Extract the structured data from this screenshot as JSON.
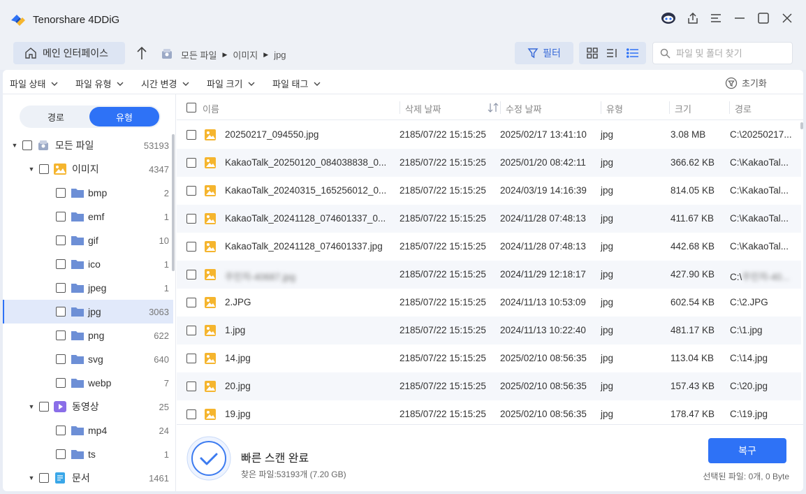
{
  "app": {
    "title": "Tenorshare 4DDiG"
  },
  "toolbar": {
    "home_label": "메인 인터페이스",
    "breadcrumb": [
      "모든 파일",
      "이미지",
      "jpg"
    ],
    "filter_label": "필터",
    "search_placeholder": "파일 및 폴더 찾기"
  },
  "filters": {
    "items": [
      "파일 상태",
      "파일 유형",
      "시간 변경",
      "파일 크기",
      "파일 태그"
    ],
    "reset_label": "초기화"
  },
  "sidebar": {
    "tabs": [
      "경로",
      "유형"
    ],
    "active_tab": "유형",
    "tree": [
      {
        "label": "모든 파일",
        "count": "53193"
      },
      {
        "label": "이미지",
        "count": "4347"
      },
      {
        "label": "bmp",
        "count": "2"
      },
      {
        "label": "emf",
        "count": "1"
      },
      {
        "label": "gif",
        "count": "10"
      },
      {
        "label": "ico",
        "count": "1"
      },
      {
        "label": "jpeg",
        "count": "1"
      },
      {
        "label": "jpg",
        "count": "3063"
      },
      {
        "label": "png",
        "count": "622"
      },
      {
        "label": "svg",
        "count": "640"
      },
      {
        "label": "webp",
        "count": "7"
      },
      {
        "label": "동영상",
        "count": "25"
      },
      {
        "label": "mp4",
        "count": "24"
      },
      {
        "label": "ts",
        "count": "1"
      },
      {
        "label": "문서",
        "count": "1461"
      }
    ]
  },
  "table": {
    "columns": [
      "이름",
      "삭제 날짜",
      "수정 날짜",
      "유형",
      "크기",
      "경로"
    ],
    "rows": [
      {
        "name": "20250217_094550.jpg",
        "deleted": "2185/07/22 15:15:25",
        "modified": "2025/02/17 13:41:10",
        "type": "jpg",
        "size": "3.08 MB",
        "path": "C:\\20250217..."
      },
      {
        "name": "KakaoTalk_20250120_084038838_0...",
        "deleted": "2185/07/22 15:15:25",
        "modified": "2025/01/20 08:42:11",
        "type": "jpg",
        "size": "366.62 KB",
        "path": "C:\\KakaoTal..."
      },
      {
        "name": "KakaoTalk_20240315_165256012_0...",
        "deleted": "2185/07/22 15:15:25",
        "modified": "2024/03/19 14:16:39",
        "type": "jpg",
        "size": "814.05 KB",
        "path": "C:\\KakaoTal..."
      },
      {
        "name": "KakaoTalk_20241128_074601337_0...",
        "deleted": "2185/07/22 15:15:25",
        "modified": "2024/11/28 07:48:13",
        "type": "jpg",
        "size": "411.67 KB",
        "path": "C:\\KakaoTal..."
      },
      {
        "name": "KakaoTalk_20241128_074601337.jpg",
        "deleted": "2185/07/22 15:15:25",
        "modified": "2024/11/28 07:48:13",
        "type": "jpg",
        "size": "442.68 KB",
        "path": "C:\\KakaoTal..."
      },
      {
        "name": "주민차-40687.jpg",
        "deleted": "2185/07/22 15:15:25",
        "modified": "2024/11/29 12:18:17",
        "type": "jpg",
        "size": "427.90 KB",
        "path": "C:\\주민차-40...",
        "blurred": true
      },
      {
        "name": "2.JPG",
        "deleted": "2185/07/22 15:15:25",
        "modified": "2024/11/13 10:53:09",
        "type": "jpg",
        "size": "602.54 KB",
        "path": "C:\\2.JPG"
      },
      {
        "name": "1.jpg",
        "deleted": "2185/07/22 15:15:25",
        "modified": "2024/11/13 10:22:40",
        "type": "jpg",
        "size": "481.17 KB",
        "path": "C:\\1.jpg"
      },
      {
        "name": "14.jpg",
        "deleted": "2185/07/22 15:15:25",
        "modified": "2025/02/10 08:56:35",
        "type": "jpg",
        "size": "113.04 KB",
        "path": "C:\\14.jpg"
      },
      {
        "name": "20.jpg",
        "deleted": "2185/07/22 15:15:25",
        "modified": "2025/02/10 08:56:35",
        "type": "jpg",
        "size": "157.43 KB",
        "path": "C:\\20.jpg"
      },
      {
        "name": "19.jpg",
        "deleted": "2185/07/22 15:15:25",
        "modified": "2025/02/10 08:56:35",
        "type": "jpg",
        "size": "178.47 KB",
        "path": "C:\\19.jpg"
      }
    ]
  },
  "footer": {
    "scan_title": "빠른 스캔 완료",
    "scan_summary": "찾은 파일:53193개 (7.20 GB)",
    "recover_label": "복구",
    "selected_info": "선택된 파일: 0개, 0 Byte"
  },
  "colors": {
    "accent": "#2e72f6",
    "folder": "#6d8fd6",
    "image_icon": "#f5b52e",
    "video_icon": "#8a6ee8"
  }
}
